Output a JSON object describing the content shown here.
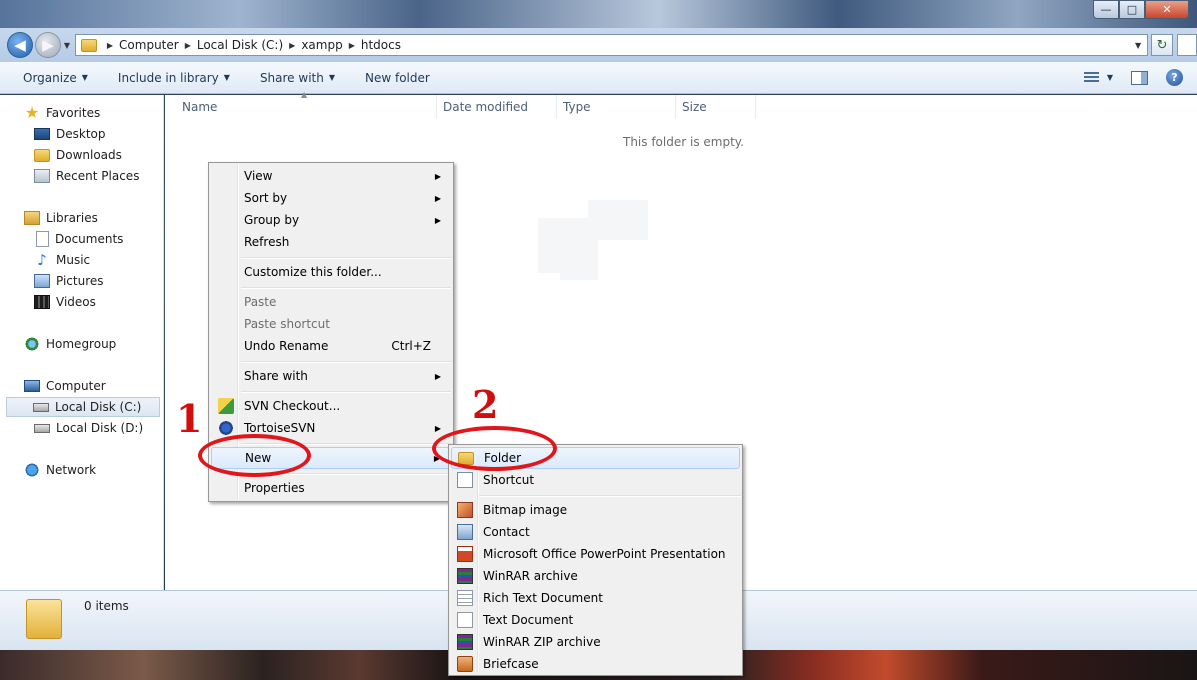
{
  "window": {
    "caption": {
      "minimize": "—",
      "maximize": "□",
      "close": "✕"
    }
  },
  "address": {
    "crumbs": [
      "Computer",
      "Local Disk (C:)",
      "xampp",
      "htdocs"
    ]
  },
  "toolbar": {
    "organize": "Organize",
    "include_in_library": "Include in library",
    "share_with": "Share with",
    "new_folder": "New folder",
    "help": "?"
  },
  "navpane": {
    "favorites": "Favorites",
    "desktop": "Desktop",
    "downloads": "Downloads",
    "recent_places": "Recent Places",
    "libraries": "Libraries",
    "documents": "Documents",
    "music": "Music",
    "pictures": "Pictures",
    "videos": "Videos",
    "homegroup": "Homegroup",
    "computer": "Computer",
    "local_disk_c": "Local Disk (C:)",
    "local_disk_d": "Local Disk (D:)",
    "network": "Network"
  },
  "columns": {
    "name": "Name",
    "date_modified": "Date modified",
    "type": "Type",
    "size": "Size"
  },
  "content": {
    "empty_message": "This folder is empty."
  },
  "details": {
    "items_count": "0 items"
  },
  "context_menu": {
    "view": "View",
    "sort_by": "Sort by",
    "group_by": "Group by",
    "refresh": "Refresh",
    "customize": "Customize this folder...",
    "paste": "Paste",
    "paste_shortcut": "Paste shortcut",
    "undo_rename": "Undo Rename",
    "undo_shortcut": "Ctrl+Z",
    "share_with": "Share with",
    "svn_checkout": "SVN Checkout...",
    "tortoise_svn": "TortoiseSVN",
    "new": "New",
    "properties": "Properties"
  },
  "new_submenu": {
    "folder": "Folder",
    "shortcut": "Shortcut",
    "bitmap": "Bitmap image",
    "contact": "Contact",
    "ppt": "Microsoft Office PowerPoint Presentation",
    "winrar": "WinRAR archive",
    "rtf": "Rich Text Document",
    "txt": "Text Document",
    "winrar_zip": "WinRAR ZIP archive",
    "briefcase": "Briefcase"
  },
  "annotations": {
    "step1": "1",
    "step2": "2",
    "color": "#e0161a"
  }
}
